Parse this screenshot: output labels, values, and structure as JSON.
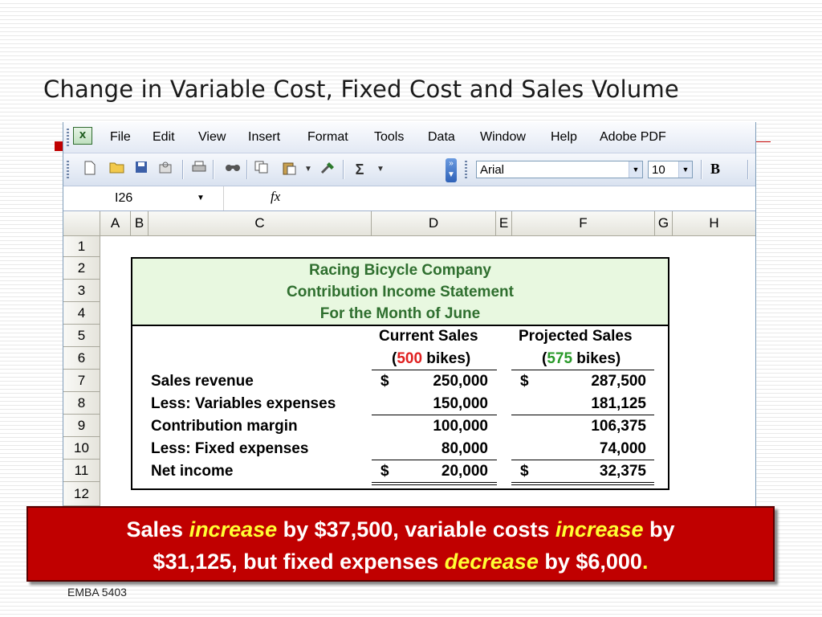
{
  "slide": {
    "title": "Change in Variable Cost, Fixed Cost and Sales Volume",
    "footer": "EMBA 5403"
  },
  "excel": {
    "menu": [
      {
        "label": "File"
      },
      {
        "label": "Edit"
      },
      {
        "label": "View"
      },
      {
        "label": "Insert"
      },
      {
        "label": "Format"
      },
      {
        "label": "Tools"
      },
      {
        "label": "Data"
      },
      {
        "label": "Window"
      },
      {
        "label": "Help"
      },
      {
        "label": "Adobe PDF"
      }
    ],
    "toolbar": {
      "font_name": "Arial",
      "font_size": "10",
      "bold_label": "B",
      "sigma_label": "Σ"
    },
    "namebox": "I26",
    "fx_label": "fx",
    "columns": [
      "A",
      "B",
      "C",
      "D",
      "E",
      "F",
      "G",
      "H"
    ],
    "rows": [
      "1",
      "2",
      "3",
      "4",
      "5",
      "6",
      "7",
      "8",
      "9",
      "10",
      "11",
      "12"
    ]
  },
  "statement": {
    "company": "Racing Bicycle Company",
    "title": "Contribution Income Statement",
    "period": "For the Month of June",
    "current_header": "Current Sales",
    "current_units_prefix": "(",
    "current_units": "500",
    "current_units_suffix": " bikes)",
    "projected_header": "Projected Sales",
    "projected_units_prefix": "(",
    "projected_units": "575",
    "projected_units_suffix": " bikes)",
    "lines": [
      {
        "label": "Sales revenue",
        "current": "250,000",
        "projected": "287,500",
        "current_sign": "$",
        "projected_sign": "$"
      },
      {
        "label": "Less: Variables expenses",
        "current": "150,000",
        "projected": "181,125"
      },
      {
        "label": "Contribution margin",
        "current": "100,000",
        "projected": "106,375"
      },
      {
        "label": "Less: Fixed expenses",
        "current": "80,000",
        "projected": "74,000"
      },
      {
        "label": "Net income",
        "current": "20,000",
        "projected": "32,375",
        "current_sign": "$",
        "projected_sign": "$"
      }
    ]
  },
  "callout": {
    "p1": "Sales ",
    "w1": "increase",
    "p2": " by $37,500,  variable costs ",
    "w2": "increase",
    "p3": " by",
    "p4": "$31,125, but fixed expenses ",
    "w3": "decrease",
    "p5": " by $6,000",
    "dot": "."
  },
  "colors": {
    "callout_bg": "#c00000",
    "callout_emphasis": "#ffff33",
    "statement_header_text": "#2f6f2f",
    "statement_header_bg": "#e8f8e0",
    "current_units_color": "#e02020",
    "projected_units_color": "#2a9a2a"
  }
}
